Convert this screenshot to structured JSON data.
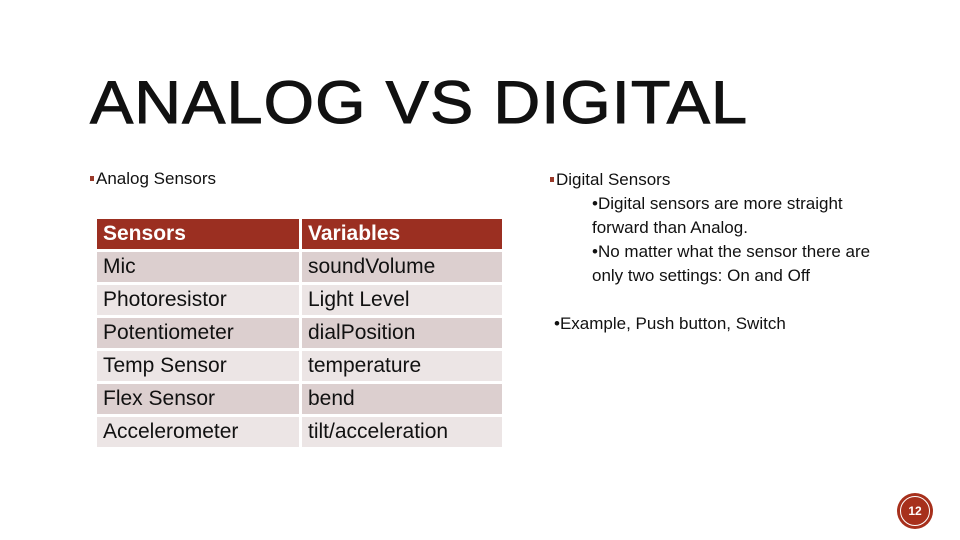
{
  "slide": {
    "title": "ANALOG VS DIGITAL",
    "page_number": "12"
  },
  "analog": {
    "heading": "Analog Sensors",
    "table": {
      "headers": [
        "Sensors",
        "Variables"
      ],
      "rows": [
        [
          "Mic",
          "soundVolume"
        ],
        [
          "Photoresistor",
          "Light Level"
        ],
        [
          "Potentiometer",
          "dialPosition"
        ],
        [
          "Temp Sensor",
          "temperature"
        ],
        [
          "Flex Sensor",
          "bend"
        ],
        [
          "Accelerometer",
          "tilt/acceleration"
        ]
      ]
    }
  },
  "digital": {
    "heading": "Digital Sensors",
    "points": [
      "•Digital sensors are more straight forward than Analog.",
      "•No matter what the sensor there are only two settings: On and Off"
    ],
    "example": "•Example, Push button, Switch"
  },
  "colors": {
    "accent": "#9b2f21",
    "row_dark": "#dccfcf",
    "row_light": "#ece5e5"
  }
}
